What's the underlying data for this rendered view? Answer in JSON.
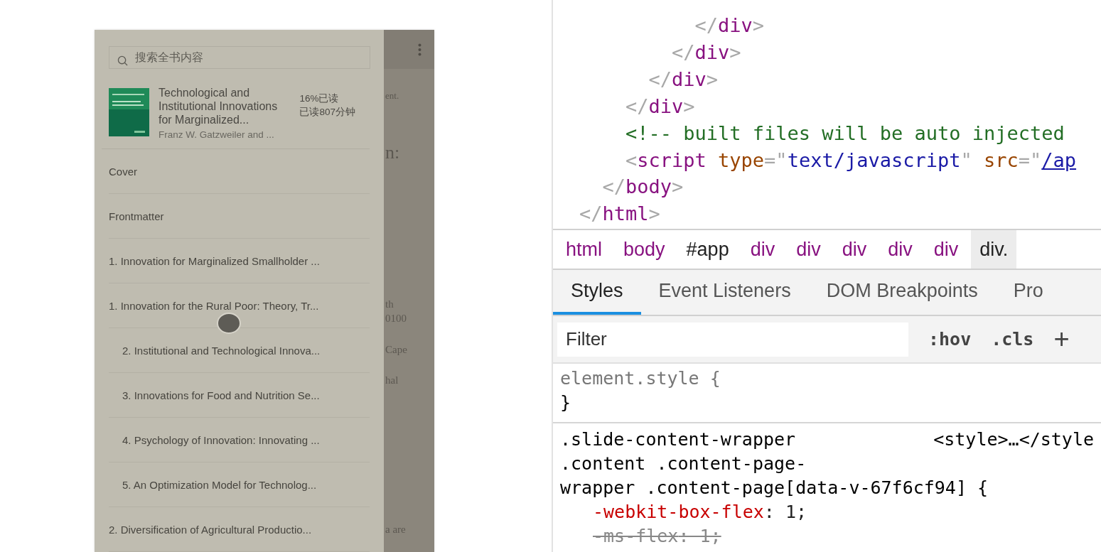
{
  "reader": {
    "search": {
      "placeholder": "搜索全书内容"
    },
    "book": {
      "title": "Technological and Institutional Innovations for Marginalized...",
      "author": "Franz W. Gatzweiler and ...",
      "progress": "16%已读",
      "time_read": "已读807分钟"
    },
    "toc": [
      {
        "label": "Cover"
      },
      {
        "label": "Frontmatter"
      },
      {
        "label": "1. Innovation for Marginalized Smallholder ..."
      },
      {
        "label": "1. Innovation for the Rural Poor: Theory, Tr...",
        "children": [
          {
            "label": "2. Institutional and Technological Innova..."
          },
          {
            "label": "3. Innovations for Food and Nutrition Se..."
          },
          {
            "label": "4. Psychology of Innovation: Innovating ..."
          },
          {
            "label": "5. An Optimization Model for Technolog..."
          }
        ]
      },
      {
        "label": "2. Diversification of Agricultural Productio..."
      }
    ],
    "behind_page": {
      "fragments": [
        "ent.",
        "n:",
        "th",
        "0100",
        "Cape",
        "hal",
        "a are"
      ]
    }
  },
  "devtools": {
    "code_lines": [
      {
        "tokens": [
          {
            "kind": "punct",
            "text": "          </"
          },
          {
            "kind": "tag",
            "text": "div"
          },
          {
            "kind": "punct",
            "text": ">"
          }
        ]
      },
      {
        "tokens": [
          {
            "kind": "punct",
            "text": "        </"
          },
          {
            "kind": "tag",
            "text": "div"
          },
          {
            "kind": "punct",
            "text": ">"
          }
        ]
      },
      {
        "tokens": [
          {
            "kind": "punct",
            "text": "      </"
          },
          {
            "kind": "tag",
            "text": "div"
          },
          {
            "kind": "punct",
            "text": ">"
          }
        ]
      },
      {
        "tokens": [
          {
            "kind": "punct",
            "text": "    </"
          },
          {
            "kind": "tag",
            "text": "div"
          },
          {
            "kind": "punct",
            "text": ">"
          }
        ]
      },
      {
        "tokens": [
          {
            "kind": "comment",
            "text": "    <!-- built files will be auto injected"
          }
        ]
      },
      {
        "tokens": [
          {
            "kind": "punct",
            "text": "    <"
          },
          {
            "kind": "tag",
            "text": "script"
          },
          {
            "kind": "attr",
            "text": " type"
          },
          {
            "kind": "punct",
            "text": "=\""
          },
          {
            "kind": "value",
            "text": "text/javascript"
          },
          {
            "kind": "punct",
            "text": "\""
          },
          {
            "kind": "attr",
            "text": " src"
          },
          {
            "kind": "punct",
            "text": "=\""
          },
          {
            "kind": "link",
            "text": "/ap"
          }
        ]
      },
      {
        "tokens": [
          {
            "kind": "punct",
            "text": "  </"
          },
          {
            "kind": "tag",
            "text": "body"
          },
          {
            "kind": "punct",
            "text": ">"
          }
        ]
      },
      {
        "tokens": [
          {
            "kind": "punct",
            "text": "</"
          },
          {
            "kind": "tag",
            "text": "html"
          },
          {
            "kind": "punct",
            "text": ">"
          }
        ]
      }
    ],
    "breadcrumbs": [
      {
        "label": "html",
        "selected": false
      },
      {
        "label": "body",
        "selected": false
      },
      {
        "label": "#app",
        "selected": false
      },
      {
        "label": "div",
        "selected": false
      },
      {
        "label": "div",
        "selected": false
      },
      {
        "label": "div",
        "selected": false
      },
      {
        "label": "div",
        "selected": false
      },
      {
        "label": "div",
        "selected": false
      },
      {
        "label": "div.",
        "selected": true
      }
    ],
    "tabs": [
      {
        "label": "Styles",
        "selected": true
      },
      {
        "label": "Event Listeners",
        "selected": false
      },
      {
        "label": "DOM Breakpoints",
        "selected": false
      },
      {
        "label": "Pro",
        "selected": false
      }
    ],
    "filter": {
      "placeholder": "Filter",
      "hov": ":hov",
      "cls": ".cls",
      "add": "+"
    },
    "element_style": {
      "open": "element.style {",
      "close": "}"
    },
    "rule": {
      "selector_lines": [
        ".slide-content-wrapper",
        ".content .content-page-",
        "wrapper .content-page[data-v-67f6cf94] {"
      ],
      "source": "<style>…</style",
      "declarations": [
        {
          "property": "-webkit-box-flex",
          "value": ": 1;",
          "overridden": false
        },
        {
          "property": "-ms-flex",
          "value": ": 1;",
          "overridden": true
        }
      ]
    }
  }
}
